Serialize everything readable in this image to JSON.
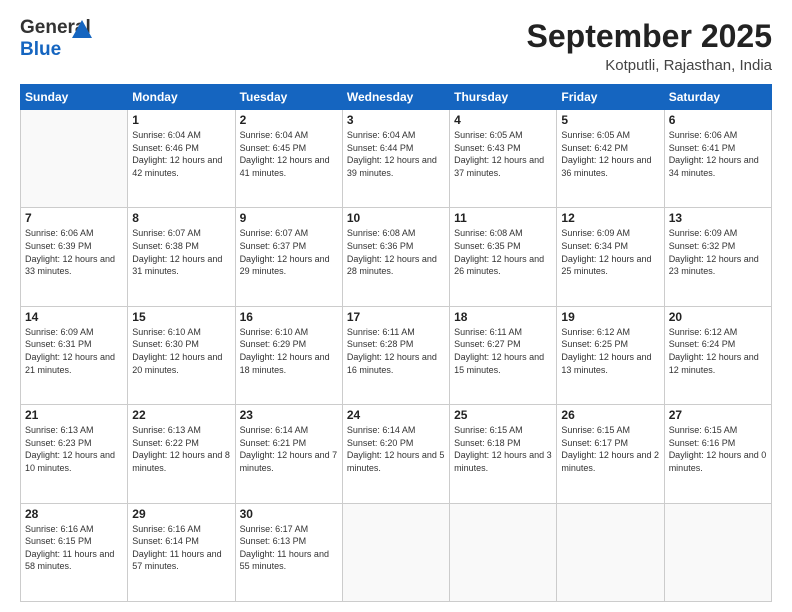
{
  "logo": {
    "general": "General",
    "blue": "Blue"
  },
  "header": {
    "month": "September 2025",
    "location": "Kotputli, Rajasthan, India"
  },
  "days_of_week": [
    "Sunday",
    "Monday",
    "Tuesday",
    "Wednesday",
    "Thursday",
    "Friday",
    "Saturday"
  ],
  "weeks": [
    [
      {
        "day": "",
        "sunrise": "",
        "sunset": "",
        "daylight": ""
      },
      {
        "day": "1",
        "sunrise": "Sunrise: 6:04 AM",
        "sunset": "Sunset: 6:46 PM",
        "daylight": "Daylight: 12 hours and 42 minutes."
      },
      {
        "day": "2",
        "sunrise": "Sunrise: 6:04 AM",
        "sunset": "Sunset: 6:45 PM",
        "daylight": "Daylight: 12 hours and 41 minutes."
      },
      {
        "day": "3",
        "sunrise": "Sunrise: 6:04 AM",
        "sunset": "Sunset: 6:44 PM",
        "daylight": "Daylight: 12 hours and 39 minutes."
      },
      {
        "day": "4",
        "sunrise": "Sunrise: 6:05 AM",
        "sunset": "Sunset: 6:43 PM",
        "daylight": "Daylight: 12 hours and 37 minutes."
      },
      {
        "day": "5",
        "sunrise": "Sunrise: 6:05 AM",
        "sunset": "Sunset: 6:42 PM",
        "daylight": "Daylight: 12 hours and 36 minutes."
      },
      {
        "day": "6",
        "sunrise": "Sunrise: 6:06 AM",
        "sunset": "Sunset: 6:41 PM",
        "daylight": "Daylight: 12 hours and 34 minutes."
      }
    ],
    [
      {
        "day": "7",
        "sunrise": "Sunrise: 6:06 AM",
        "sunset": "Sunset: 6:39 PM",
        "daylight": "Daylight: 12 hours and 33 minutes."
      },
      {
        "day": "8",
        "sunrise": "Sunrise: 6:07 AM",
        "sunset": "Sunset: 6:38 PM",
        "daylight": "Daylight: 12 hours and 31 minutes."
      },
      {
        "day": "9",
        "sunrise": "Sunrise: 6:07 AM",
        "sunset": "Sunset: 6:37 PM",
        "daylight": "Daylight: 12 hours and 29 minutes."
      },
      {
        "day": "10",
        "sunrise": "Sunrise: 6:08 AM",
        "sunset": "Sunset: 6:36 PM",
        "daylight": "Daylight: 12 hours and 28 minutes."
      },
      {
        "day": "11",
        "sunrise": "Sunrise: 6:08 AM",
        "sunset": "Sunset: 6:35 PM",
        "daylight": "Daylight: 12 hours and 26 minutes."
      },
      {
        "day": "12",
        "sunrise": "Sunrise: 6:09 AM",
        "sunset": "Sunset: 6:34 PM",
        "daylight": "Daylight: 12 hours and 25 minutes."
      },
      {
        "day": "13",
        "sunrise": "Sunrise: 6:09 AM",
        "sunset": "Sunset: 6:32 PM",
        "daylight": "Daylight: 12 hours and 23 minutes."
      }
    ],
    [
      {
        "day": "14",
        "sunrise": "Sunrise: 6:09 AM",
        "sunset": "Sunset: 6:31 PM",
        "daylight": "Daylight: 12 hours and 21 minutes."
      },
      {
        "day": "15",
        "sunrise": "Sunrise: 6:10 AM",
        "sunset": "Sunset: 6:30 PM",
        "daylight": "Daylight: 12 hours and 20 minutes."
      },
      {
        "day": "16",
        "sunrise": "Sunrise: 6:10 AM",
        "sunset": "Sunset: 6:29 PM",
        "daylight": "Daylight: 12 hours and 18 minutes."
      },
      {
        "day": "17",
        "sunrise": "Sunrise: 6:11 AM",
        "sunset": "Sunset: 6:28 PM",
        "daylight": "Daylight: 12 hours and 16 minutes."
      },
      {
        "day": "18",
        "sunrise": "Sunrise: 6:11 AM",
        "sunset": "Sunset: 6:27 PM",
        "daylight": "Daylight: 12 hours and 15 minutes."
      },
      {
        "day": "19",
        "sunrise": "Sunrise: 6:12 AM",
        "sunset": "Sunset: 6:25 PM",
        "daylight": "Daylight: 12 hours and 13 minutes."
      },
      {
        "day": "20",
        "sunrise": "Sunrise: 6:12 AM",
        "sunset": "Sunset: 6:24 PM",
        "daylight": "Daylight: 12 hours and 12 minutes."
      }
    ],
    [
      {
        "day": "21",
        "sunrise": "Sunrise: 6:13 AM",
        "sunset": "Sunset: 6:23 PM",
        "daylight": "Daylight: 12 hours and 10 minutes."
      },
      {
        "day": "22",
        "sunrise": "Sunrise: 6:13 AM",
        "sunset": "Sunset: 6:22 PM",
        "daylight": "Daylight: 12 hours and 8 minutes."
      },
      {
        "day": "23",
        "sunrise": "Sunrise: 6:14 AM",
        "sunset": "Sunset: 6:21 PM",
        "daylight": "Daylight: 12 hours and 7 minutes."
      },
      {
        "day": "24",
        "sunrise": "Sunrise: 6:14 AM",
        "sunset": "Sunset: 6:20 PM",
        "daylight": "Daylight: 12 hours and 5 minutes."
      },
      {
        "day": "25",
        "sunrise": "Sunrise: 6:15 AM",
        "sunset": "Sunset: 6:18 PM",
        "daylight": "Daylight: 12 hours and 3 minutes."
      },
      {
        "day": "26",
        "sunrise": "Sunrise: 6:15 AM",
        "sunset": "Sunset: 6:17 PM",
        "daylight": "Daylight: 12 hours and 2 minutes."
      },
      {
        "day": "27",
        "sunrise": "Sunrise: 6:15 AM",
        "sunset": "Sunset: 6:16 PM",
        "daylight": "Daylight: 12 hours and 0 minutes."
      }
    ],
    [
      {
        "day": "28",
        "sunrise": "Sunrise: 6:16 AM",
        "sunset": "Sunset: 6:15 PM",
        "daylight": "Daylight: 11 hours and 58 minutes."
      },
      {
        "day": "29",
        "sunrise": "Sunrise: 6:16 AM",
        "sunset": "Sunset: 6:14 PM",
        "daylight": "Daylight: 11 hours and 57 minutes."
      },
      {
        "day": "30",
        "sunrise": "Sunrise: 6:17 AM",
        "sunset": "Sunset: 6:13 PM",
        "daylight": "Daylight: 11 hours and 55 minutes."
      },
      {
        "day": "",
        "sunrise": "",
        "sunset": "",
        "daylight": ""
      },
      {
        "day": "",
        "sunrise": "",
        "sunset": "",
        "daylight": ""
      },
      {
        "day": "",
        "sunrise": "",
        "sunset": "",
        "daylight": ""
      },
      {
        "day": "",
        "sunrise": "",
        "sunset": "",
        "daylight": ""
      }
    ]
  ]
}
